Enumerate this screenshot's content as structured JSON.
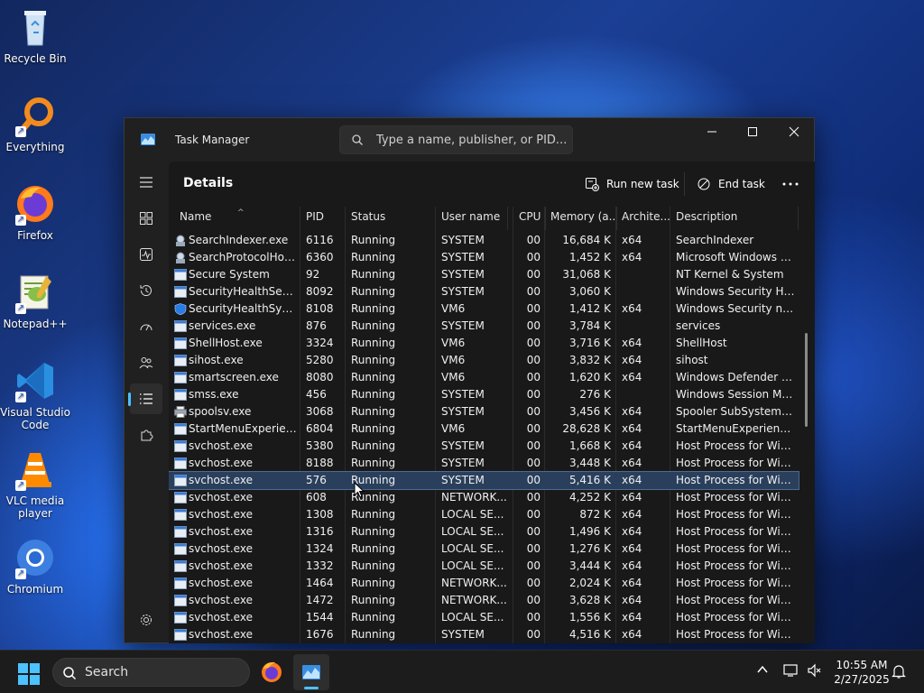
{
  "desktop": {
    "icons": [
      {
        "label": "Recycle Bin"
      },
      {
        "label": "Everything"
      },
      {
        "label": "Firefox"
      },
      {
        "label": "Notepad++"
      },
      {
        "label": "Visual Studio Code"
      },
      {
        "label": "VLC media player"
      },
      {
        "label": "Chromium"
      }
    ]
  },
  "window": {
    "title": "Task Manager",
    "search_placeholder": "Type a name, publisher, or PID...",
    "page_title": "Details",
    "run_new_task": "Run new task",
    "end_task": "End task",
    "columns": [
      "Name",
      "PID",
      "Status",
      "User name",
      "CPU",
      "Memory (a...",
      "Archite...",
      "Description"
    ],
    "rows": [
      {
        "name": "SearchIndexer.exe",
        "pid": "6116",
        "status": "Running",
        "user": "SYSTEM",
        "cpu": "00",
        "mem": "16,684 K",
        "arch": "x64",
        "desc": "SearchIndexer",
        "icon": "indexer"
      },
      {
        "name": "SearchProtocolHost....",
        "pid": "6360",
        "status": "Running",
        "user": "SYSTEM",
        "cpu": "00",
        "mem": "1,452 K",
        "arch": "x64",
        "desc": "Microsoft Windows Se...",
        "icon": "indexer"
      },
      {
        "name": "Secure System",
        "pid": "92",
        "status": "Running",
        "user": "SYSTEM",
        "cpu": "00",
        "mem": "31,068 K",
        "arch": "",
        "desc": "NT Kernel & System",
        "icon": "window"
      },
      {
        "name": "SecurityHealthServic...",
        "pid": "8092",
        "status": "Running",
        "user": "SYSTEM",
        "cpu": "00",
        "mem": "3,060 K",
        "arch": "",
        "desc": "Windows Security Hea...",
        "icon": "window"
      },
      {
        "name": "SecurityHealthSystra...",
        "pid": "8108",
        "status": "Running",
        "user": "VM6",
        "cpu": "00",
        "mem": "1,412 K",
        "arch": "x64",
        "desc": "Windows Security noti...",
        "icon": "shield"
      },
      {
        "name": "services.exe",
        "pid": "876",
        "status": "Running",
        "user": "SYSTEM",
        "cpu": "00",
        "mem": "3,784 K",
        "arch": "",
        "desc": "services",
        "icon": "window"
      },
      {
        "name": "ShellHost.exe",
        "pid": "3324",
        "status": "Running",
        "user": "VM6",
        "cpu": "00",
        "mem": "3,716 K",
        "arch": "x64",
        "desc": "ShellHost",
        "icon": "window"
      },
      {
        "name": "sihost.exe",
        "pid": "5280",
        "status": "Running",
        "user": "VM6",
        "cpu": "00",
        "mem": "3,832 K",
        "arch": "x64",
        "desc": "sihost",
        "icon": "window"
      },
      {
        "name": "smartscreen.exe",
        "pid": "8080",
        "status": "Running",
        "user": "VM6",
        "cpu": "00",
        "mem": "1,620 K",
        "arch": "x64",
        "desc": "Windows Defender S...",
        "icon": "window"
      },
      {
        "name": "smss.exe",
        "pid": "456",
        "status": "Running",
        "user": "SYSTEM",
        "cpu": "00",
        "mem": "276 K",
        "arch": "",
        "desc": "Windows Session Man...",
        "icon": "window"
      },
      {
        "name": "spoolsv.exe",
        "pid": "3068",
        "status": "Running",
        "user": "SYSTEM",
        "cpu": "00",
        "mem": "3,456 K",
        "arch": "x64",
        "desc": "Spooler SubSystem App",
        "icon": "printer"
      },
      {
        "name": "StartMenuExperience...",
        "pid": "6804",
        "status": "Running",
        "user": "VM6",
        "cpu": "00",
        "mem": "28,628 K",
        "arch": "x64",
        "desc": "StartMenuExperience...",
        "icon": "window"
      },
      {
        "name": "svchost.exe",
        "pid": "5380",
        "status": "Running",
        "user": "SYSTEM",
        "cpu": "00",
        "mem": "1,668 K",
        "arch": "x64",
        "desc": "Host Process for Wind...",
        "icon": "window"
      },
      {
        "name": "svchost.exe",
        "pid": "8188",
        "status": "Running",
        "user": "SYSTEM",
        "cpu": "00",
        "mem": "3,448 K",
        "arch": "x64",
        "desc": "Host Process for Wind...",
        "icon": "window"
      },
      {
        "name": "svchost.exe",
        "pid": "576",
        "status": "Running",
        "user": "SYSTEM",
        "cpu": "00",
        "mem": "5,416 K",
        "arch": "x64",
        "desc": "Host Process for Wind...",
        "icon": "window",
        "selected": true
      },
      {
        "name": "svchost.exe",
        "pid": "608",
        "status": "Running",
        "user": "NETWORK...",
        "cpu": "00",
        "mem": "4,252 K",
        "arch": "x64",
        "desc": "Host Process for Wind...",
        "icon": "window"
      },
      {
        "name": "svchost.exe",
        "pid": "1308",
        "status": "Running",
        "user": "LOCAL SE...",
        "cpu": "00",
        "mem": "872 K",
        "arch": "x64",
        "desc": "Host Process for Wind...",
        "icon": "window"
      },
      {
        "name": "svchost.exe",
        "pid": "1316",
        "status": "Running",
        "user": "LOCAL SE...",
        "cpu": "00",
        "mem": "1,496 K",
        "arch": "x64",
        "desc": "Host Process for Wind...",
        "icon": "window"
      },
      {
        "name": "svchost.exe",
        "pid": "1324",
        "status": "Running",
        "user": "LOCAL SE...",
        "cpu": "00",
        "mem": "1,276 K",
        "arch": "x64",
        "desc": "Host Process for Wind...",
        "icon": "window"
      },
      {
        "name": "svchost.exe",
        "pid": "1332",
        "status": "Running",
        "user": "LOCAL SE...",
        "cpu": "00",
        "mem": "3,444 K",
        "arch": "x64",
        "desc": "Host Process for Wind...",
        "icon": "window"
      },
      {
        "name": "svchost.exe",
        "pid": "1464",
        "status": "Running",
        "user": "NETWORK...",
        "cpu": "00",
        "mem": "2,024 K",
        "arch": "x64",
        "desc": "Host Process for Wind...",
        "icon": "window"
      },
      {
        "name": "svchost.exe",
        "pid": "1472",
        "status": "Running",
        "user": "NETWORK...",
        "cpu": "00",
        "mem": "3,628 K",
        "arch": "x64",
        "desc": "Host Process for Wind...",
        "icon": "window"
      },
      {
        "name": "svchost.exe",
        "pid": "1544",
        "status": "Running",
        "user": "LOCAL SE...",
        "cpu": "00",
        "mem": "1,556 K",
        "arch": "x64",
        "desc": "Host Process for Wind...",
        "icon": "window"
      },
      {
        "name": "svchost.exe",
        "pid": "1676",
        "status": "Running",
        "user": "SYSTEM",
        "cpu": "00",
        "mem": "4,516 K",
        "arch": "x64",
        "desc": "Host Process for Wind...",
        "icon": "window"
      }
    ]
  },
  "taskbar": {
    "search_label": "Search",
    "time": "10:55 AM",
    "date": "2/27/2025"
  },
  "colors": {
    "accent": "#4cc2ff",
    "selected_row": "#2a3f5c"
  }
}
